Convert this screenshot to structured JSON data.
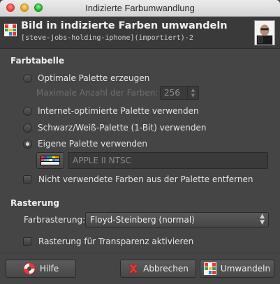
{
  "window": {
    "title": "Indizierte Farbumwandlung",
    "controls": [
      "close-button",
      "minimize-button",
      "zoom-button"
    ]
  },
  "header": {
    "title": "Bild in indizierte Farben umwandeln",
    "subtitle": "[steve-jobs-holding-iphone](importiert)-2",
    "icon": "indexed-color-icon"
  },
  "colormap": {
    "section_label": "Farbtabelle",
    "options": [
      {
        "label": "Optimale Palette erzeugen",
        "checked": false
      },
      {
        "label": "Internet-optimierte Palette verwenden",
        "checked": false
      },
      {
        "label": "Schwarz/Weiß-Palette (1-Bit) verwenden",
        "checked": false
      },
      {
        "label": "Eigene Palette verwenden",
        "checked": true
      }
    ],
    "max_colors_label": "Maximale Anzahl der Farben:",
    "max_colors_value": "256",
    "palette_name": "APPLE II NTSC",
    "remove_unused_label": "Nicht verwendete Farben aus der Palette entfernen",
    "remove_unused_checked": false
  },
  "dithering": {
    "section_label": "Rasterung",
    "color_dither_label": "Farbrasterung:",
    "color_dither_value": "Floyd-Steinberg (normal)",
    "transparency_label": "Rasterung für Transparenz aktivieren",
    "transparency_checked": false
  },
  "buttons": {
    "help": "Hilfe",
    "cancel": "Abbrechen",
    "convert": "Umwandeln"
  },
  "colors": {
    "background": "#454545",
    "header_bg": "#3a3a3a",
    "text": "#e6e6e6"
  }
}
